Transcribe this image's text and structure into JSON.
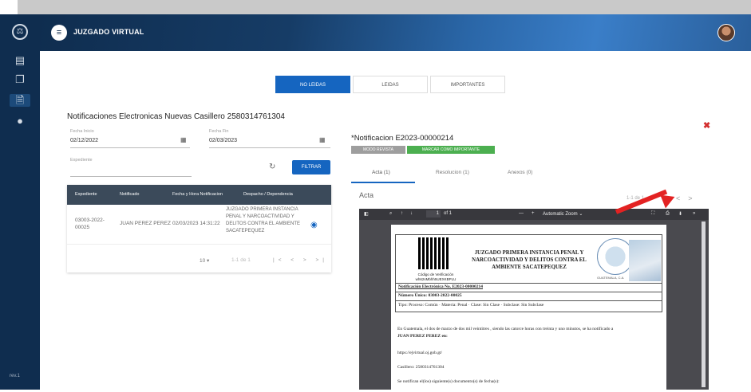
{
  "header": {
    "title": "JUZGADO VIRTUAL"
  },
  "sidebar": {
    "version": "rev.1"
  },
  "tabs": [
    {
      "label": "NO LEIDAS",
      "active": true
    },
    {
      "label": "LEIDAS",
      "active": false
    },
    {
      "label": "IMPORTANTES",
      "active": false
    }
  ],
  "page_heading": "Notificaciones Electronicas Nuevas Casillero 2580314761304",
  "filters": {
    "fecha_inicio_label": "Fecha Inicio",
    "fecha_inicio_value": "02/12/2022",
    "fecha_fin_label": "Fecha Fin",
    "fecha_fin_value": "02/03/2023",
    "expediente_label": "Expediente",
    "filter_button": "FILTRAR"
  },
  "table": {
    "headers": [
      "Expediente",
      "Notificado",
      "Fecha y Hora Notificacion",
      "Despacho / Dependencia"
    ],
    "row": {
      "expediente_1": "03003-2022-",
      "expediente_2": "00025",
      "notificado": "JUAN PEREZ PEREZ",
      "fecha": "02/03/2023 14:31:22",
      "despacho_1": "JUZGADO PRIMERA INSTANCIA",
      "despacho_2": "PENAL Y NARCOACTIVIDAD Y",
      "despacho_3": "DELITOS CONTRA EL AMBIENTE",
      "despacho_4": "SACATEPEQUEZ"
    },
    "per_page": "10",
    "range": "1-1 de 1"
  },
  "notification": {
    "title": "*Notificacion E2023-00000214",
    "mode_badge": "MODO REVISTA",
    "important_button": "MARCAR COMO IMPORTANTE",
    "subtabs": [
      "Acta (1)",
      "Resolucion (1)",
      "Anexos (0)"
    ],
    "section_label": "Acta",
    "range": "1-1 de 1"
  },
  "viewer": {
    "page_input": "1",
    "page_total": "of 1",
    "zoom": "Automatic Zoom"
  },
  "document": {
    "court_1": "JUZGADO PRIMERA INSTANCIA PENAL Y",
    "court_2": "NARCOACTIVIDAD Y DELITOS CONTRA EL",
    "court_3": "AMBIENTE SACATEPEQUEZ",
    "qr_caption_1": "Código de Verificación",
    "qr_caption_2": "wh62sMbhh5UEXKBPLU",
    "seal_caption": "GUATEMALA, C.A.",
    "line_1": "Notificación Electrónica No. E2023-00000214",
    "line_2": "Número Único: 03003-2022-00025",
    "line_3": "Tipo: Proceso: Común · Materia: Penal · Clase: Sin Clase · Subclase: Sin Subclase",
    "para_1": "En Guatemala, el dos de marzo de dos mil veintitres , siendo las catorce horas con treinta y uno minutos, se ha notificado a",
    "para_1b": "JUAN PEREZ PEREZ en:",
    "para_2": "https://ejvirtual.oj.gob.gt/",
    "para_3": "Casillero: 2580314761304",
    "para_4": "Se notifican el(los) siguiente(s) documento(s) de fecha(s):"
  },
  "colors": {
    "primary": "#1565c0",
    "sidebar": "#0f2d4f",
    "important": "#4caf50",
    "close": "#d32f2f"
  }
}
